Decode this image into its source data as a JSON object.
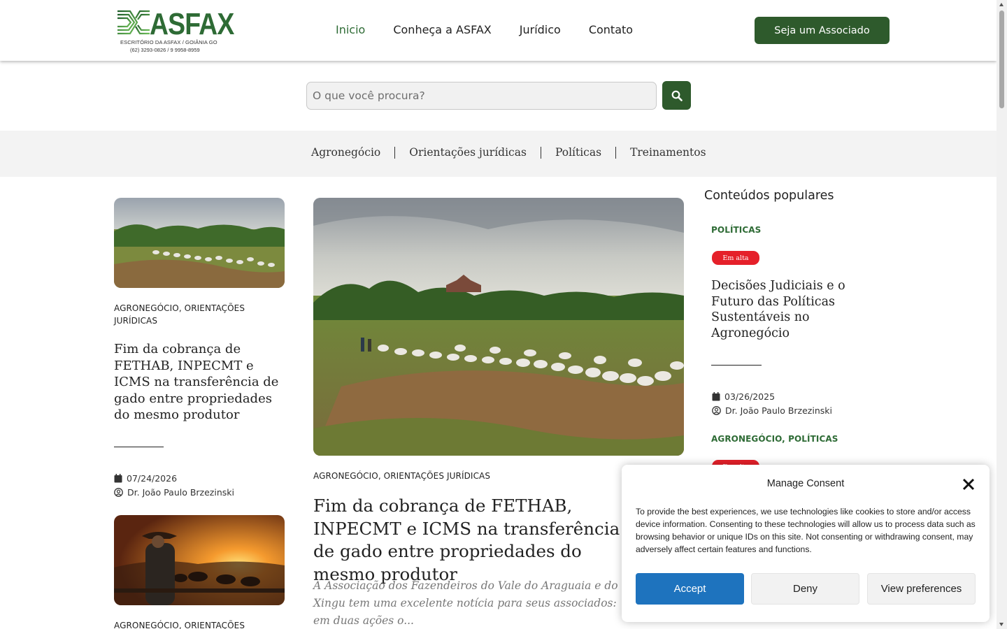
{
  "header": {
    "logo": {
      "name": "ASFAX",
      "subtitle": "ESCRITÓRIO DA ASFAX / GOIÂNIA GO",
      "phones": "(62) 3293-0826 / 9 9958-8959"
    },
    "nav": [
      {
        "label": "Inicio",
        "active": true
      },
      {
        "label": "Conheça a ASFAX",
        "active": false
      },
      {
        "label": "Jurídico",
        "active": false
      },
      {
        "label": "Contato",
        "active": false
      }
    ],
    "cta_label": "Seja um Associado"
  },
  "search": {
    "placeholder": "O que você procura?",
    "button_icon": "search-icon"
  },
  "categories": [
    "Agronegócio",
    "Orientações jurídicas",
    "Políticas",
    "Treinamentos"
  ],
  "left_posts": [
    {
      "categories": "AGRONEGÓCIO, ORIENTAÇÕES JURÍDICAS",
      "title": "Fim da cobrança de FETHAB, INPECMT e ICMS na transferência de gado entre propriedades do mesmo produtor",
      "date": "07/24/2026",
      "author": "Dr. João Paulo Brzezinski"
    },
    {
      "categories": "AGRONEGÓCIO, ORIENTAÇÕES"
    }
  ],
  "featured": {
    "categories": "AGRONEGÓCIO, ORIENTAÇÕES JURÍDICAS",
    "title": "Fim da cobrança de FETHAB, INPECMT e ICMS na transferência de gado entre propriedades do mesmo produtor",
    "excerpt": "A Associação dos Fazendeiros do Vale do Araguaia e do Xingu tem uma excelente notícia para seus associados: em duas ações o..."
  },
  "sidebar": {
    "heading": "Conteúdos populares",
    "items": [
      {
        "category": "POLÍTICAS",
        "badge": "Em alta",
        "title": "Decisões Judiciais e o Futuro das Políticas Sustentáveis no Agronegócio",
        "date": "03/26/2025",
        "author": "Dr. João Paulo Brzezinski"
      },
      {
        "category": "AGRONEGÓCIO, POLÍTICAS",
        "badge": "Em alta"
      }
    ]
  },
  "consent": {
    "title": "Manage Consent",
    "text": "To provide the best experiences, we use technologies like cookies to store and/or access device information. Consenting to these technologies will allow us to process data such as browsing behavior or unique IDs on this site. Not consenting or withdrawing consent, may adversely affect certain features and functions.",
    "accept": "Accept",
    "deny": "Deny",
    "preferences": "View preferences"
  },
  "colors": {
    "brand_green": "#2e5a2c",
    "accept_blue": "#1e73be",
    "badge_red": "#e5202a"
  }
}
